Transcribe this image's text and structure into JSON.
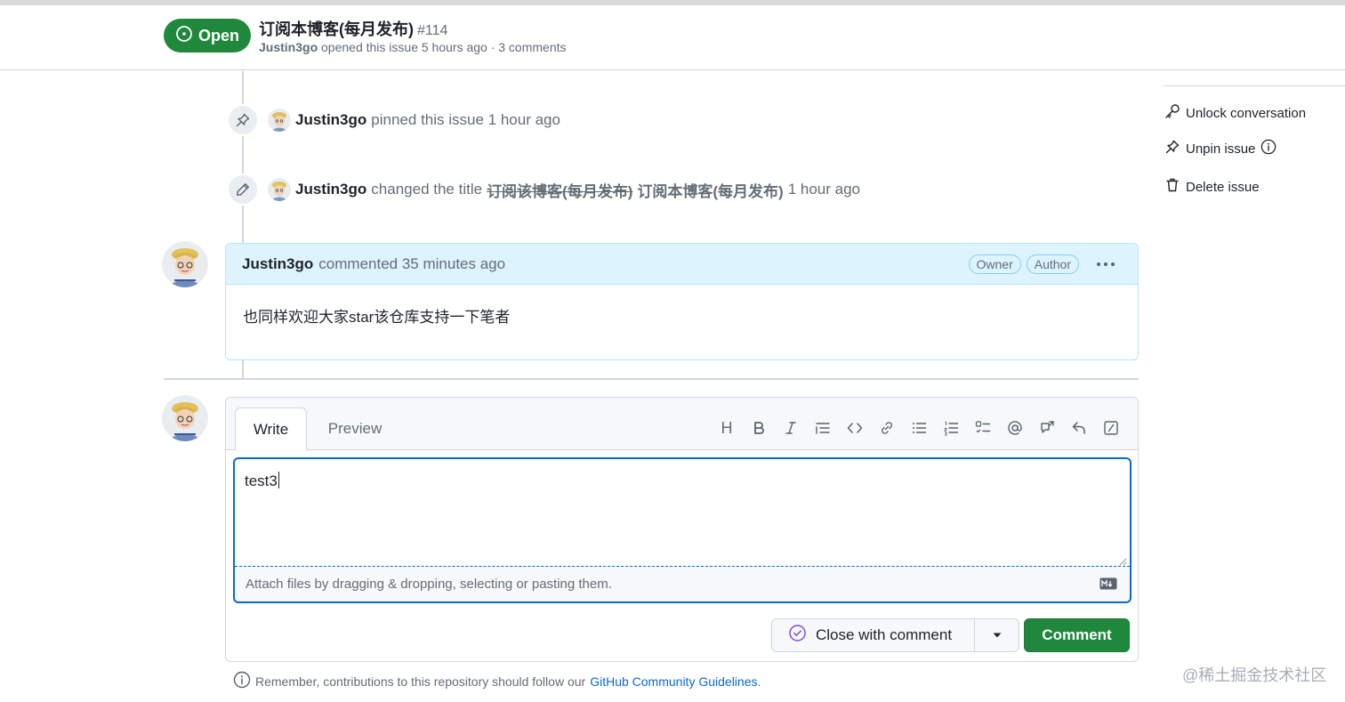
{
  "header": {
    "state_label": "Open",
    "title": "订阅本博客(每月发布)",
    "number": "#114",
    "author": "Justin3go",
    "meta_rest": "opened this issue 5 hours ago · 3 comments"
  },
  "timeline": {
    "pinned_event": {
      "user": "Justin3go",
      "action": "pinned this issue",
      "time": "1 hour ago"
    },
    "rename_event": {
      "user": "Justin3go",
      "action": "changed the title",
      "old_title": "订阅该博客(每月发布)",
      "new_title": "订阅本博客(每月发布)",
      "time": "1 hour ago"
    },
    "comment": {
      "user": "Justin3go",
      "action": "commented 35 minutes ago",
      "badges": [
        "Owner",
        "Author"
      ],
      "body": "也同样欢迎大家star该仓库支持一下笔者"
    }
  },
  "composer": {
    "tabs": [
      "Write",
      "Preview"
    ],
    "toolbar_icons": [
      "heading-icon",
      "bold-icon",
      "italic-icon",
      "quote-icon",
      "code-icon",
      "link-icon",
      "bulleted-list-icon",
      "numbered-list-icon",
      "task-list-icon",
      "mention-icon",
      "cross-reference-icon",
      "reply-icon",
      "slash-commands-icon"
    ],
    "heading_letter": "H",
    "input_value": "test3",
    "attach_hint": "Attach files by dragging & dropping, selecting or pasting them.",
    "close_label": "Close with comment",
    "comment_label": "Comment"
  },
  "guidelines": {
    "text": "Remember, contributions to this repository should follow our",
    "link": "GitHub Community Guidelines",
    "suffix": "."
  },
  "sidebar": {
    "items": [
      {
        "label": "Unlock conversation",
        "icon": "key-icon"
      },
      {
        "label": "Unpin issue",
        "icon": "pin-slash-icon"
      },
      {
        "label": "Delete issue",
        "icon": "trash-icon"
      }
    ]
  },
  "watermark": "@稀土掘金技术社区",
  "colors": {
    "open_green": "#1f883d",
    "accent_blue": "#0969da",
    "comment_header_bg": "#ddf4ff",
    "close_icon_purple": "#8250df"
  }
}
